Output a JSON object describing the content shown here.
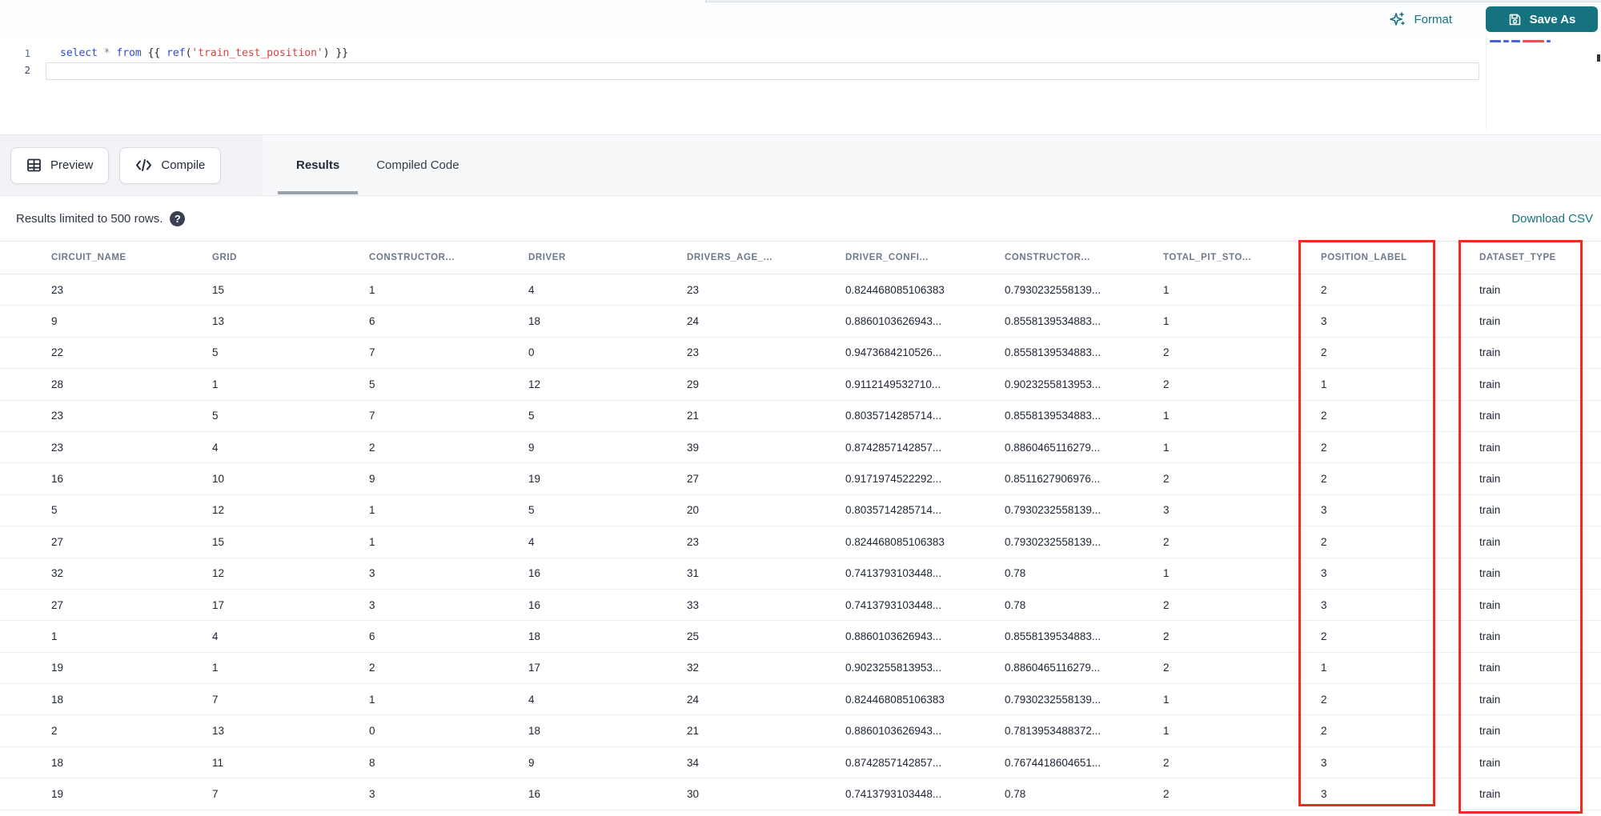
{
  "topbar": {
    "format_label": "Format",
    "save_as_label": "Save As"
  },
  "editor": {
    "lines": [
      {
        "number": "1",
        "tokens": [
          {
            "text": "select",
            "type": "keyword"
          },
          {
            "text": " ",
            "type": "jinja"
          },
          {
            "text": "*",
            "type": "operator"
          },
          {
            "text": " ",
            "type": "jinja"
          },
          {
            "text": "from",
            "type": "keyword"
          },
          {
            "text": " {{ ",
            "type": "jinja"
          },
          {
            "text": "ref",
            "type": "function"
          },
          {
            "text": "(",
            "type": "jinja"
          },
          {
            "text": "'train_test_position'",
            "type": "string"
          },
          {
            "text": ")",
            "type": "jinja"
          },
          {
            "text": " }}",
            "type": "jinja"
          }
        ]
      },
      {
        "number": "2",
        "tokens": []
      }
    ]
  },
  "toolbar": {
    "preview_label": "Preview",
    "compile_label": "Compile",
    "tabs": [
      {
        "label": "Results",
        "active": true
      },
      {
        "label": "Compiled Code",
        "active": false
      }
    ]
  },
  "results_bar": {
    "info": "Results limited to 500 rows.",
    "download_label": "Download CSV"
  },
  "table": {
    "columns": [
      "CIRCUIT_NAME",
      "GRID",
      "CONSTRUCTOR...",
      "DRIVER",
      "DRIVERS_AGE_...",
      "DRIVER_CONFI...",
      "CONSTRUCTOR...",
      "TOTAL_PIT_STO...",
      "POSITION_LABEL",
      "DATASET_TYPE"
    ],
    "highlighted_columns": [
      "POSITION_LABEL",
      "DATASET_TYPE"
    ],
    "rows": [
      [
        "23",
        "15",
        "1",
        "4",
        "23",
        "0.824468085106383",
        "0.7930232558139...",
        "1",
        "2",
        "train"
      ],
      [
        "9",
        "13",
        "6",
        "18",
        "24",
        "0.8860103626943...",
        "0.8558139534883...",
        "1",
        "3",
        "train"
      ],
      [
        "22",
        "5",
        "7",
        "0",
        "23",
        "0.9473684210526...",
        "0.8558139534883...",
        "2",
        "2",
        "train"
      ],
      [
        "28",
        "1",
        "5",
        "12",
        "29",
        "0.9112149532710...",
        "0.9023255813953...",
        "2",
        "1",
        "train"
      ],
      [
        "23",
        "5",
        "7",
        "5",
        "21",
        "0.8035714285714...",
        "0.8558139534883...",
        "1",
        "2",
        "train"
      ],
      [
        "23",
        "4",
        "2",
        "9",
        "39",
        "0.8742857142857...",
        "0.8860465116279...",
        "1",
        "2",
        "train"
      ],
      [
        "16",
        "10",
        "9",
        "19",
        "27",
        "0.9171974522292...",
        "0.8511627906976...",
        "2",
        "2",
        "train"
      ],
      [
        "5",
        "12",
        "1",
        "5",
        "20",
        "0.8035714285714...",
        "0.7930232558139...",
        "3",
        "3",
        "train"
      ],
      [
        "27",
        "15",
        "1",
        "4",
        "23",
        "0.824468085106383",
        "0.7930232558139...",
        "2",
        "2",
        "train"
      ],
      [
        "32",
        "12",
        "3",
        "16",
        "31",
        "0.7413793103448...",
        "0.78",
        "1",
        "3",
        "train"
      ],
      [
        "27",
        "17",
        "3",
        "16",
        "33",
        "0.7413793103448...",
        "0.78",
        "2",
        "3",
        "train"
      ],
      [
        "1",
        "4",
        "6",
        "18",
        "25",
        "0.8860103626943...",
        "0.8558139534883...",
        "2",
        "2",
        "train"
      ],
      [
        "19",
        "1",
        "2",
        "17",
        "32",
        "0.9023255813953...",
        "0.8860465116279...",
        "2",
        "1",
        "train"
      ],
      [
        "18",
        "7",
        "1",
        "4",
        "24",
        "0.824468085106383",
        "0.7930232558139...",
        "1",
        "2",
        "train"
      ],
      [
        "2",
        "13",
        "0",
        "18",
        "21",
        "0.8860103626943...",
        "0.7813953488372...",
        "1",
        "2",
        "train"
      ],
      [
        "18",
        "11",
        "8",
        "9",
        "34",
        "0.8742857142857...",
        "0.7674418604651...",
        "2",
        "3",
        "train"
      ],
      [
        "19",
        "7",
        "3",
        "16",
        "30",
        "0.7413793103448...",
        "0.78",
        "2",
        "3",
        "train"
      ]
    ]
  },
  "colors": {
    "accent_teal": "#14737f",
    "annotation_red": "#ee2b1f",
    "keyword_blue": "#2f4bd1",
    "string_red": "#dd3f3b"
  }
}
